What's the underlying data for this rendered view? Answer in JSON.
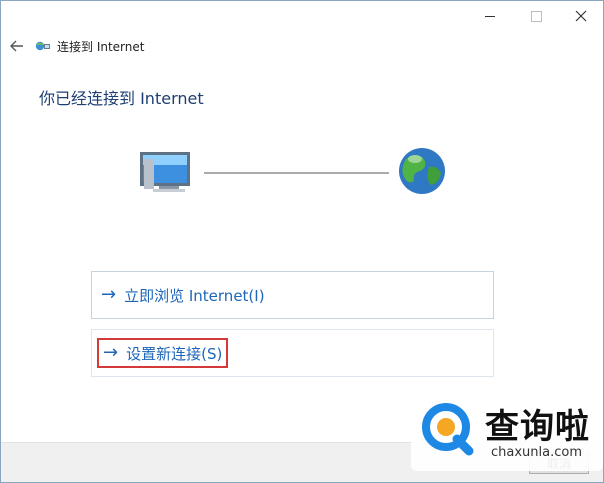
{
  "window": {
    "header_title": "连接到 Internet",
    "main_title": "你已经连接到 Internet"
  },
  "options": [
    {
      "label": "立即浏览 Internet(I)",
      "highlighted": false
    },
    {
      "label": "设置新连接(S)",
      "highlighted": true
    }
  ],
  "footer": {
    "cancel_label": "取消"
  },
  "watermark": {
    "text": "查询啦",
    "url": "chaxunla.com"
  },
  "icons": {
    "back": "back-arrow-icon",
    "app": "network-connection-icon",
    "computer": "computer-monitor-icon",
    "globe": "globe-icon",
    "option_arrow": "right-arrow-icon"
  },
  "colors": {
    "link_blue": "#1e66b8",
    "title_blue": "#1f3f73",
    "highlight_red": "#d43a3a",
    "watermark_blue": "#1e88e5"
  }
}
